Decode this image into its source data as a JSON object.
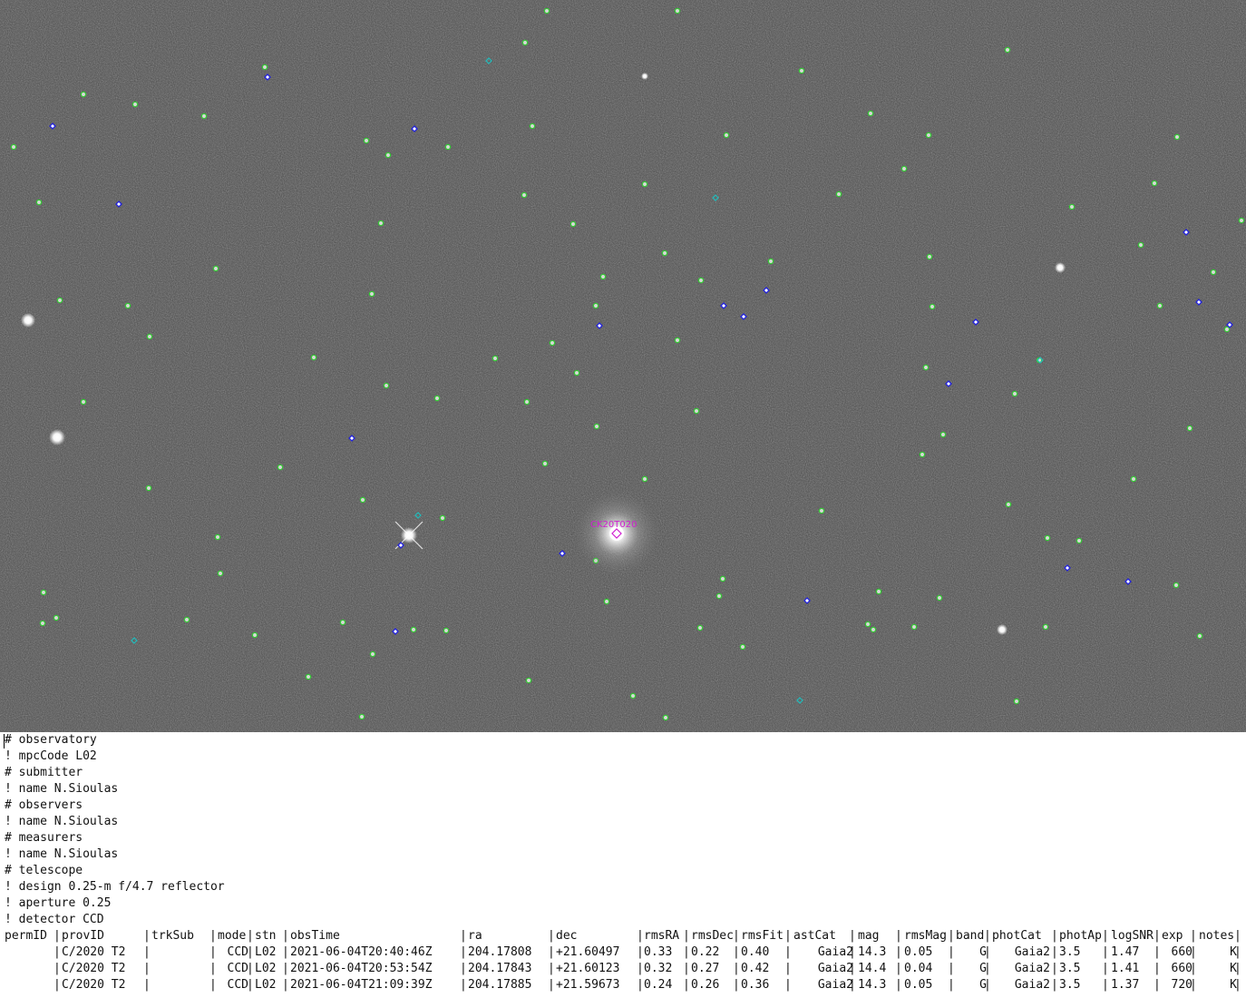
{
  "image": {
    "comet_label": "CK20T020",
    "background_color": "#4a4a4a",
    "label_color": "#d020d0",
    "reference_star_marker_color": "#33cc33",
    "other_star_marker_color": "#2222dd"
  },
  "header_lines": [
    "# observatory",
    "! mpcCode L02",
    "# submitter",
    "! name N.Sioulas",
    "# observers",
    "! name N.Sioulas",
    "# measurers",
    "! name N.Sioulas",
    "# telescope",
    "! design 0.25-m f/4.7 reflector",
    "! aperture 0.25",
    "! detector CCD"
  ],
  "table": {
    "columns": [
      "permID",
      "provID",
      "trkSub",
      "mode",
      "stn",
      "obsTime",
      "ra",
      "dec",
      "rmsRA",
      "rmsDec",
      "rmsFit",
      "astCat",
      "mag",
      "rmsMag",
      "band",
      "photCat",
      "photAp",
      "logSNR",
      "exp",
      "notes"
    ],
    "rows": [
      [
        "",
        "C/2020 T2",
        "",
        "CCD",
        "L02",
        "2021-06-04T20:40:46Z",
        "204.17808",
        "+21.60497",
        "0.33",
        "0.22",
        "0.40",
        "Gaia2",
        "14.3",
        "0.05",
        "G",
        "Gaia2",
        "3.5",
        "1.47",
        "660",
        "K"
      ],
      [
        "",
        "C/2020 T2",
        "",
        "CCD",
        "L02",
        "2021-06-04T20:53:54Z",
        "204.17843",
        "+21.60123",
        "0.32",
        "0.27",
        "0.42",
        "Gaia2",
        "14.4",
        "0.04",
        "G",
        "Gaia2",
        "3.5",
        "1.41",
        "660",
        "K"
      ],
      [
        "",
        "C/2020 T2",
        "",
        "CCD",
        "L02",
        "2021-06-04T21:09:39Z",
        "204.17885",
        "+21.59673",
        "0.24",
        "0.26",
        "0.36",
        "Gaia2",
        "14.3",
        "0.05",
        "G",
        "Gaia2",
        "3.5",
        "1.37",
        "720",
        "K"
      ]
    ]
  }
}
